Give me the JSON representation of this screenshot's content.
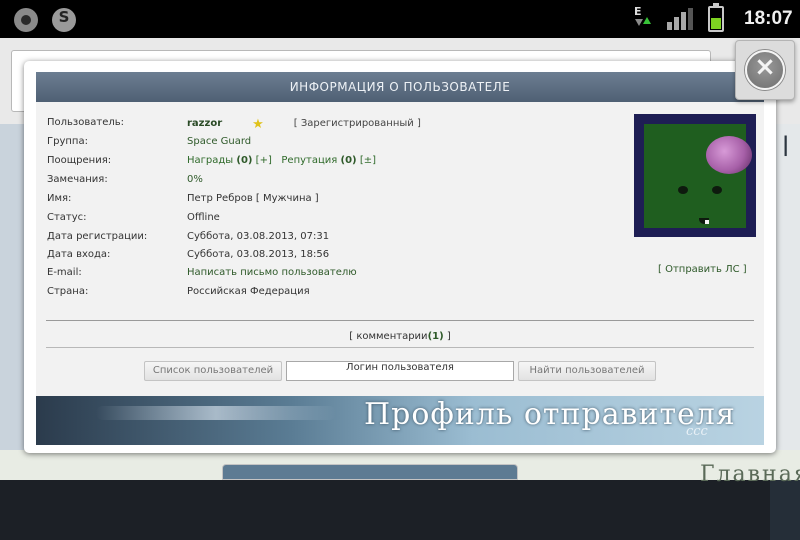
{
  "status_bar": {
    "time": "18:07",
    "network_letter": "E",
    "signal_icon": "signal-bars-icon",
    "battery_icon": "battery-icon",
    "battery_color": "#7ed321",
    "app_icon_skype_letter": "S"
  },
  "dialog": {
    "title": "ИНФОРМАЦИЯ О ПОЛЬЗОВАТЕЛЕ",
    "fields": {
      "user_label": "Пользователь:",
      "user_value": "razzor",
      "user_status_tag": "[ Зарегистрированный ]",
      "group_label": "Группа:",
      "group_value": "Space Guard",
      "rewards_label": "Поощрения:",
      "awards_text": "Награды",
      "awards_count": "(0)",
      "awards_add": "[+]",
      "reputation_text": "Репутация",
      "reputation_count": "(0)",
      "reputation_change": "[±]",
      "warnings_label": "Замечания:",
      "warnings_value": "0%",
      "name_label": "Имя:",
      "name_value": "Петр Ребров [ Мужчина ]",
      "status_label": "Статус:",
      "status_value": "Offline",
      "regdate_label": "Дата регистрации:",
      "regdate_value": "Суббота, 03.08.2013, 07:31",
      "logindate_label": "Дата входа:",
      "logindate_value": "Суббота, 03.08.2013, 18:56",
      "email_label": "E-mail:",
      "email_value": "Написать письмо пользователю",
      "country_label": "Страна:",
      "country_value": "Российская Федерация"
    },
    "send_pm": "[ Отправить ЛС ]",
    "comments": {
      "prefix": "[",
      "label": "комментарии",
      "count": "(1)",
      "suffix": "]"
    },
    "buttons": {
      "user_list": "Список пользователей",
      "login_placeholder": "Логин пользователя",
      "find_users": "Найти пользователей"
    },
    "banner": {
      "text": "Профиль отправителя",
      "signature": "ccc"
    }
  },
  "background": {
    "footer_text": "Главная"
  },
  "colors": {
    "title_bar": "#5b6d81",
    "link_green": "#2f5a2a",
    "accent_star": "#e0c21a"
  }
}
